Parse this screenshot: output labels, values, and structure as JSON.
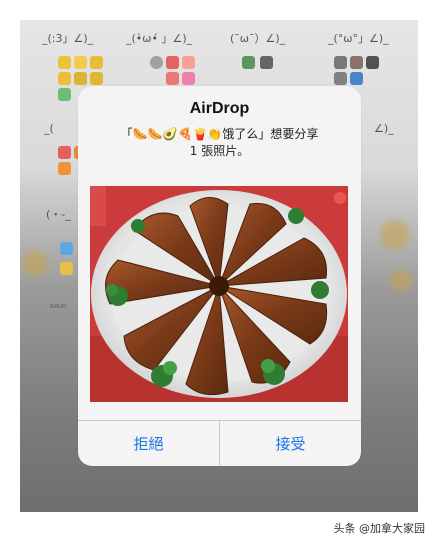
{
  "background": {
    "kaomoji_row1": [
      "_(:3」∠)_",
      "_(•̀ω•́ 」∠)_",
      "(¯ω¯）∠)_",
      "_(°ω°」∠)_"
    ],
    "kaomoji_row2": [
      "_(",
      "∠)_"
    ],
    "kaomoji_side": [
      "(・-_",
      "ᴿᴬᵁᴼ"
    ]
  },
  "dialog": {
    "title": "AirDrop",
    "message_line1": "「🌭🌭🥑🍕🍟👏饿了么」想要分享",
    "message_line2": "1 張照片。",
    "decline_label": "拒絕",
    "accept_label": "接受"
  },
  "colors": {
    "button_text": "#1a73e8",
    "dialog_bg": "#f4f4f5"
  },
  "watermark": "头条 @加拿大家园"
}
